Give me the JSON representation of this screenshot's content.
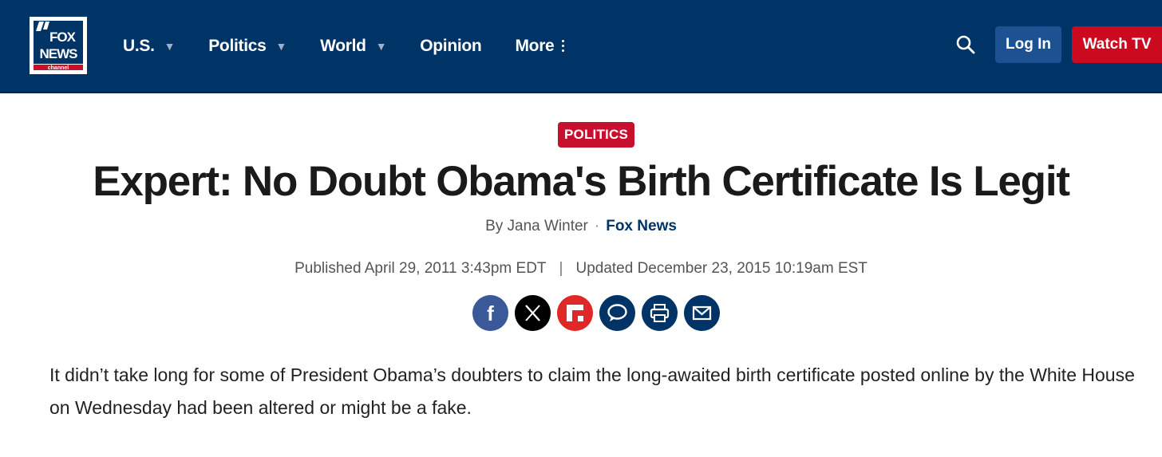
{
  "nav": {
    "logo_alt": "FOX NEWS channel",
    "items": [
      {
        "label": "U.S.",
        "has_caret": true
      },
      {
        "label": "Politics",
        "has_caret": true
      },
      {
        "label": "World",
        "has_caret": true
      },
      {
        "label": "Opinion",
        "has_caret": false
      },
      {
        "label": "More",
        "has_caret": false
      }
    ],
    "search_icon": "search-icon",
    "login_label": "Log In",
    "watch_label": "Watch TV"
  },
  "article": {
    "eyebrow": "POLITICS",
    "headline": "Expert: No Doubt Obama's Birth Certificate Is Legit",
    "byline_prefix": "By Jana Winter",
    "byline_separator": "·",
    "source": "Fox News",
    "published": "Published April 29, 2011 3:43pm EDT",
    "date_separator": "|",
    "updated": "Updated December 23, 2015 10:19am EST",
    "share_icons": [
      "facebook-icon",
      "x-icon",
      "flipboard-icon",
      "comment-icon",
      "print-icon",
      "email-icon"
    ],
    "body": "It didn’t take long for some of President Obama’s doubters to claim the long-awaited birth certificate posted online by the White House on Wednesday had been altered or might be a fake."
  },
  "colors": {
    "nav_bg": "#003366",
    "login_bg": "#1c5292",
    "watch_bg": "#cc0a1f",
    "eyebrow_bg": "#c8102e",
    "facebook": "#3b5998",
    "flipboard": "#e12828",
    "dark_blue": "#003366"
  }
}
